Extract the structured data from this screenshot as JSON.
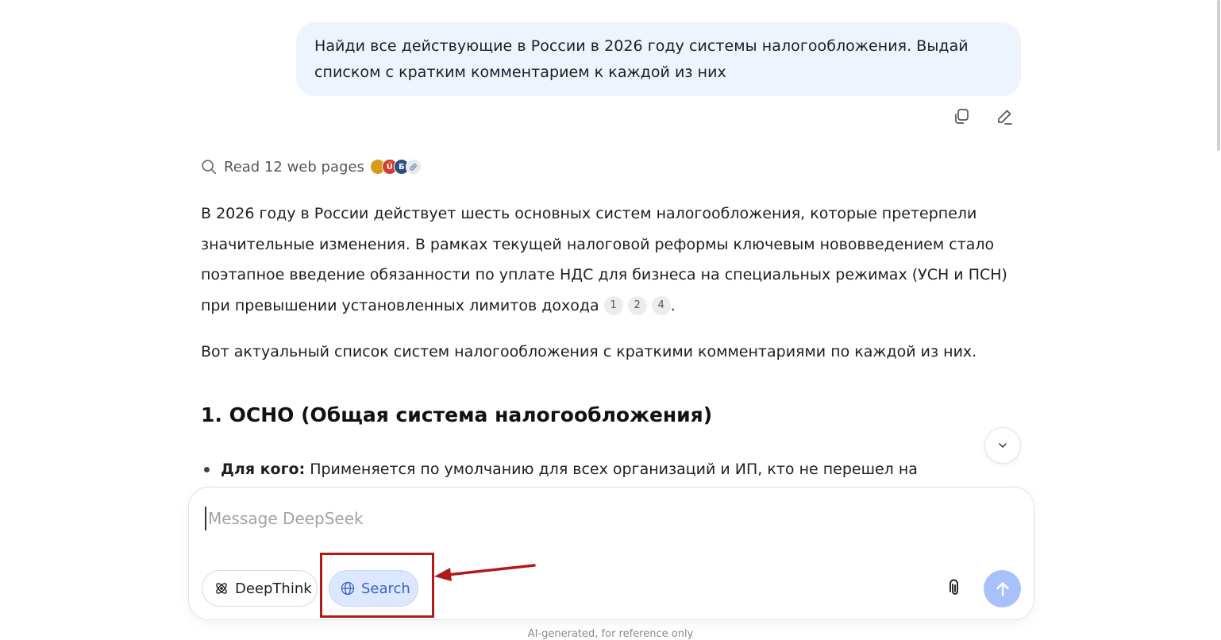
{
  "user_message": {
    "line1": "Найди все действующие в России в 2026 году системы налогообложения. Выдай",
    "line2": "списком с кратким комментарием к каждой из них"
  },
  "message_actions": {
    "copy_icon": "copy-icon",
    "edit_icon": "edit-icon"
  },
  "sources": {
    "label": "Read 12 web pages",
    "favicons": [
      {
        "letter": "",
        "color": "#d59b1c"
      },
      {
        "letter": "Ú",
        "color": "#d63a2b"
      },
      {
        "letter": "Б",
        "color": "#2c4f86"
      },
      {
        "letter": "🔗",
        "color": "#e6e9ef"
      }
    ]
  },
  "answer": {
    "para1_line1": "В 2026 году в России действует шесть основных систем налогообложения, которые претерпели",
    "para1_line2": "значительные изменения. В рамках текущей налоговой реформы ключевым нововведением стало",
    "para1_line3": "поэтапное введение обязанности по уплате НДС для бизнеса на специальных режимах (УСН и ПСН)",
    "para1_line4": "при превышении установленных лимитов дохода",
    "citations": [
      "1",
      "2",
      "4"
    ],
    "para1_end": ".",
    "para2": "Вот актуальный список систем налогообложения с краткими комментариями по каждой из них.",
    "heading1": "1. ОСНО (Общая система налогообложения)",
    "bullet1_label": "Для кого:",
    "bullet1_text": "Применяется по умолчанию для всех организаций и ИП, кто не перешел на"
  },
  "composer": {
    "placeholder": "Message DeepSeek",
    "deepthink_label": "DeepThink",
    "search_label": "Search",
    "search_active": true
  },
  "footer": {
    "note": "AI-generated, for reference only"
  },
  "colors": {
    "bubble": "#eef4fe",
    "search_pill_bg": "#dbe8ff",
    "search_pill_text": "#3b63c4",
    "send_button": "#a9c1fb",
    "annotation_red": "#b01a1a"
  }
}
